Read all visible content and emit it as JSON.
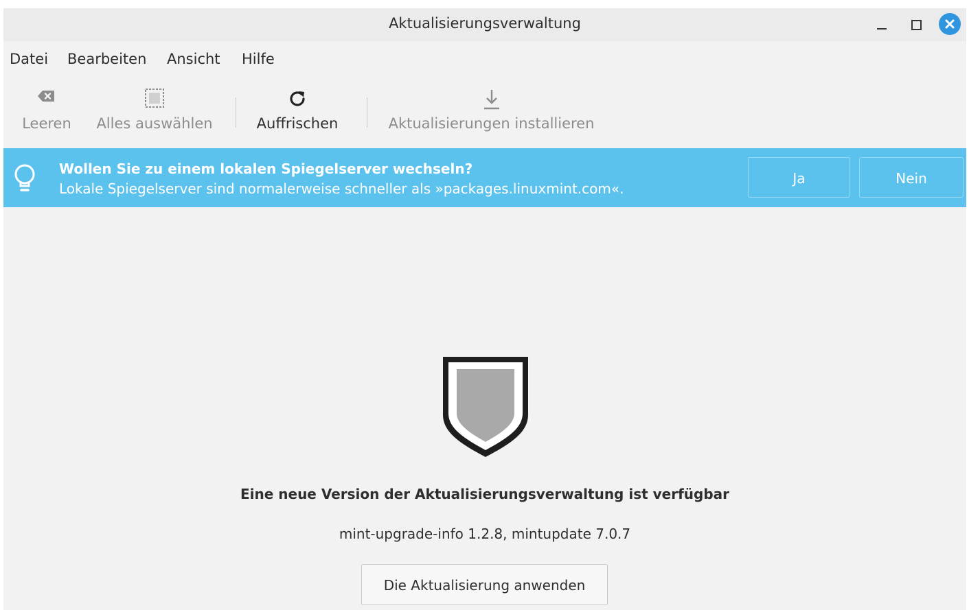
{
  "window": {
    "title": "Aktualisierungsverwaltung",
    "controls": [
      "minimize-icon",
      "maximize-icon",
      "close-icon"
    ],
    "close_color": "#2f95de"
  },
  "menubar": {
    "items": [
      "Datei",
      "Bearbeiten",
      "Ansicht",
      "Hilfe"
    ]
  },
  "toolbar": {
    "clear": {
      "label": "Leeren",
      "icon": "clear-icon",
      "enabled": false
    },
    "select_all": {
      "label": "Alles auswählen",
      "icon": "select-all-icon",
      "enabled": false
    },
    "refresh": {
      "label": "Auffrischen",
      "icon": "refresh-icon",
      "enabled": true
    },
    "install": {
      "label": "Aktualisierungen installieren",
      "icon": "download-icon",
      "enabled": false
    }
  },
  "infobar": {
    "icon": "lightbulb-icon",
    "title": "Wollen Sie zu einem lokalen Spiegelserver wechseln?",
    "text": "Lokale Spiegelserver sind normalerweise schneller als »packages.linuxmint.com«.",
    "yes_label": "Ja",
    "no_label": "Nein",
    "color": "#5bc2ee"
  },
  "main": {
    "icon": "shield-icon",
    "headline": "Eine neue Version der Aktualisierungsverwaltung ist verfügbar",
    "versions": "mint-upgrade-info 1.2.8, mintupdate 7.0.7",
    "apply_label": "Die Aktualisierung anwenden"
  }
}
